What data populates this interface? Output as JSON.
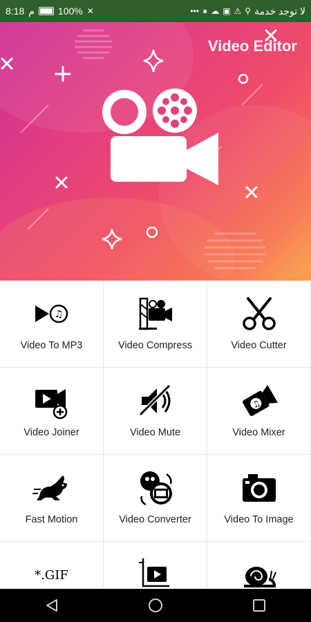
{
  "status_bar": {
    "time": "8:18",
    "am_pm": "م",
    "battery": "100%",
    "carrier": "لا توجد خدمة"
  },
  "header": {
    "title": "Video Editor"
  },
  "tools": [
    {
      "label": "Video To MP3",
      "icon": "video-to-mp3-icon"
    },
    {
      "label": "Video Compress",
      "icon": "video-compress-icon"
    },
    {
      "label": "Video Cutter",
      "icon": "scissors-icon"
    },
    {
      "label": "Video Joiner",
      "icon": "video-joiner-icon"
    },
    {
      "label": "Video Mute",
      "icon": "mute-icon"
    },
    {
      "label": "Video Mixer",
      "icon": "video-mixer-icon"
    },
    {
      "label": "Fast Motion",
      "icon": "rabbit-icon"
    },
    {
      "label": "Video Converter",
      "icon": "video-converter-icon"
    },
    {
      "label": "Video To Image",
      "icon": "camera-icon"
    },
    {
      "label": "",
      "icon": "gif-icon",
      "icon_text": "*.GIF"
    },
    {
      "label": "",
      "icon": "video-crop-icon"
    },
    {
      "label": "",
      "icon": "snail-icon"
    }
  ],
  "nav": {
    "back": "back-icon",
    "home": "home-icon",
    "recents": "recents-icon"
  },
  "colors": {
    "status_bar": "#2f5f2a",
    "gradient_start": "#cf2e96",
    "gradient_end": "#f9a148",
    "nav_bar": "#000000"
  }
}
